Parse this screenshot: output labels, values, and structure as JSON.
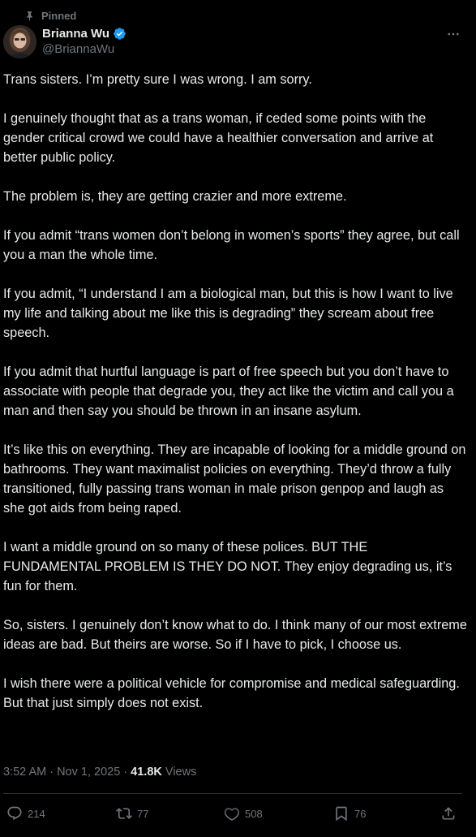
{
  "pinned_label": "Pinned",
  "author": {
    "display_name": "Brianna Wu",
    "handle": "@BriannaWu",
    "verified": true,
    "verified_color": "#1d9bf0"
  },
  "post": {
    "paragraphs": [
      "Trans sisters. I’m pretty sure I was wrong. I am sorry.",
      "I genuinely thought that as a trans woman, if ceded some points with the gender critical crowd we could have a healthier conversation and arrive at better public policy.",
      "The problem is, they are getting crazier and more extreme.",
      "If you admit “trans women don’t belong in women’s sports” they agree, but call you a man the whole time.",
      "If you admit, “I understand I am a biological man, but this is how I want to live my life and talking about me like this is degrading” they scream about free speech.",
      "If you admit that hurtful language is part of free speech but you don’t have to associate with people that degrade you, they act like the victim and call you a man and then say you should be thrown in an insane asylum.",
      "It’s like this on everything. They are incapable of looking for a middle ground on bathrooms. They want maximalist policies on everything. They’d throw a fully transitioned, fully passing trans woman in male prison genpop and laugh as she got aids from being raped.",
      "I want a middle ground on so many of these polices. BUT THE FUNDAMENTAL PROBLEM IS THEY DO NOT. They enjoy degrading us, it’s fun for them.",
      "So, sisters. I genuinely don’t know what to do. I think many of our most extreme ideas are bad. But theirs are worse. So if I have to pick, I choose us.",
      "I wish there were a political vehicle for compromise and medical safeguarding. But that just simply does not exist."
    ],
    "timestamp": "3:52 AM · Nov 1, 2025",
    "separator": " · ",
    "views_count": "41.8K",
    "views_label": "Views"
  },
  "actions": {
    "reply_count": "214",
    "repost_count": "77",
    "like_count": "508",
    "bookmark_count": "76"
  },
  "icons": {
    "pinned": "pin-icon",
    "verified": "verified-badge-icon",
    "more": "more-options-icon",
    "reply": "reply-icon",
    "repost": "repost-icon",
    "like": "heart-icon",
    "bookmark": "bookmark-icon",
    "share": "share-icon"
  },
  "colors": {
    "background": "#000000",
    "text_primary": "#e7e9ea",
    "text_secondary": "#71767b",
    "divider": "#2f3336",
    "accent": "#1d9bf0"
  }
}
